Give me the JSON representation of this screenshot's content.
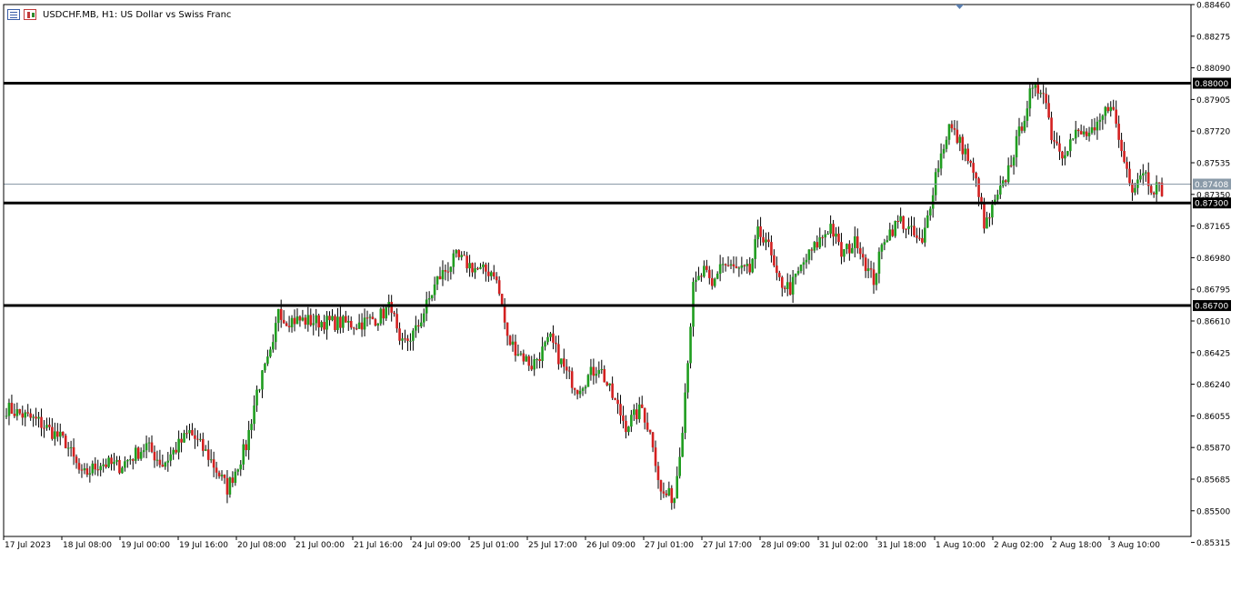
{
  "header": {
    "title": "USDCHF.MB, H1:  US Dollar vs Swiss Franc",
    "icons": [
      "menu-icon",
      "candle-chart-icon"
    ]
  },
  "colors": {
    "bull": "#1f9d1f",
    "bear": "#d32020",
    "wick": "#000000",
    "level_line": "#000000",
    "current_price_line": "#8a9aa8",
    "axis_text": "#000000",
    "current_price_badge": "#8a9aa8"
  },
  "chart_data": {
    "type": "candlestick",
    "symbol": "USDCHF.MB",
    "timeframe": "H1",
    "title": "USDCHF.MB, H1:  US Dollar vs Swiss Franc",
    "ylim": [
      0.8535,
      0.8846
    ],
    "y_ticks": [
      "0.88460",
      "0.88275",
      "0.88090",
      "0.87905",
      "0.87720",
      "0.87535",
      "0.87350",
      "0.87165",
      "0.86980",
      "0.86795",
      "0.86610",
      "0.86425",
      "0.86240",
      "0.86055",
      "0.85870",
      "0.85685",
      "0.85500",
      "0.85315"
    ],
    "x_ticks": [
      "17 Jul 2023",
      "18 Jul 08:00",
      "19 Jul 00:00",
      "19 Jul 16:00",
      "20 Jul 08:00",
      "21 Jul 00:00",
      "21 Jul 16:00",
      "24 Jul 09:00",
      "25 Jul 01:00",
      "25 Jul 17:00",
      "26 Jul 09:00",
      "27 Jul 01:00",
      "27 Jul 17:00",
      "28 Jul 09:00",
      "31 Jul 02:00",
      "31 Jul 18:00",
      "1 Aug 10:00",
      "2 Aug 02:00",
      "2 Aug 18:00",
      "3 Aug 10:00"
    ],
    "levels": [
      {
        "price": 0.88,
        "label": "0.88000"
      },
      {
        "price": 0.873,
        "label": "0.87300"
      },
      {
        "price": 0.867,
        "label": "0.86700"
      }
    ],
    "current_price": {
      "price": 0.8741,
      "label": "0.87408"
    },
    "grid": false,
    "waypoints": [
      [
        0,
        0.861
      ],
      [
        12,
        0.8602
      ],
      [
        22,
        0.859
      ],
      [
        28,
        0.857
      ],
      [
        35,
        0.8578
      ],
      [
        42,
        0.8576
      ],
      [
        52,
        0.8588
      ],
      [
        58,
        0.8577
      ],
      [
        68,
        0.8596
      ],
      [
        75,
        0.8582
      ],
      [
        82,
        0.8563
      ],
      [
        89,
        0.8588
      ],
      [
        93,
        0.862
      ],
      [
        99,
        0.8645
      ],
      [
        101,
        0.867
      ],
      [
        103,
        0.8662
      ],
      [
        122,
        0.866
      ],
      [
        130,
        0.8659
      ],
      [
        138,
        0.8663
      ],
      [
        143,
        0.867
      ],
      [
        146,
        0.8645
      ],
      [
        152,
        0.8655
      ],
      [
        160,
        0.8685
      ],
      [
        167,
        0.8698
      ],
      [
        176,
        0.869
      ],
      [
        181,
        0.869
      ],
      [
        184,
        0.867
      ],
      [
        186,
        0.865
      ],
      [
        195,
        0.8635
      ],
      [
        202,
        0.865
      ],
      [
        208,
        0.863
      ],
      [
        212,
        0.8622
      ],
      [
        220,
        0.8635
      ],
      [
        224,
        0.862
      ],
      [
        230,
        0.86
      ],
      [
        236,
        0.861
      ],
      [
        240,
        0.859
      ],
      [
        243,
        0.856
      ],
      [
        248,
        0.8558
      ],
      [
        251,
        0.86
      ],
      [
        255,
        0.868
      ],
      [
        259,
        0.869
      ],
      [
        262,
        0.868
      ],
      [
        265,
        0.8695
      ],
      [
        272,
        0.869
      ],
      [
        276,
        0.869
      ],
      [
        279,
        0.8712
      ],
      [
        282,
        0.871
      ],
      [
        286,
        0.8685
      ],
      [
        291,
        0.868
      ],
      [
        296,
        0.8695
      ],
      [
        306,
        0.8717
      ],
      [
        310,
        0.87
      ],
      [
        316,
        0.8708
      ],
      [
        320,
        0.869
      ],
      [
        322,
        0.8685
      ],
      [
        326,
        0.871
      ],
      [
        332,
        0.872
      ],
      [
        340,
        0.8705
      ],
      [
        345,
        0.8747
      ],
      [
        350,
        0.8775
      ],
      [
        356,
        0.876
      ],
      [
        361,
        0.8737
      ],
      [
        363,
        0.8715
      ],
      [
        370,
        0.874
      ],
      [
        375,
        0.8765
      ],
      [
        380,
        0.8793
      ],
      [
        385,
        0.8798
      ],
      [
        388,
        0.877
      ],
      [
        392,
        0.876
      ],
      [
        397,
        0.877
      ],
      [
        404,
        0.877
      ],
      [
        410,
        0.879
      ],
      [
        414,
        0.876
      ],
      [
        418,
        0.874
      ],
      [
        422,
        0.875
      ],
      [
        425,
        0.874
      ],
      [
        429,
        0.8738
      ]
    ]
  }
}
